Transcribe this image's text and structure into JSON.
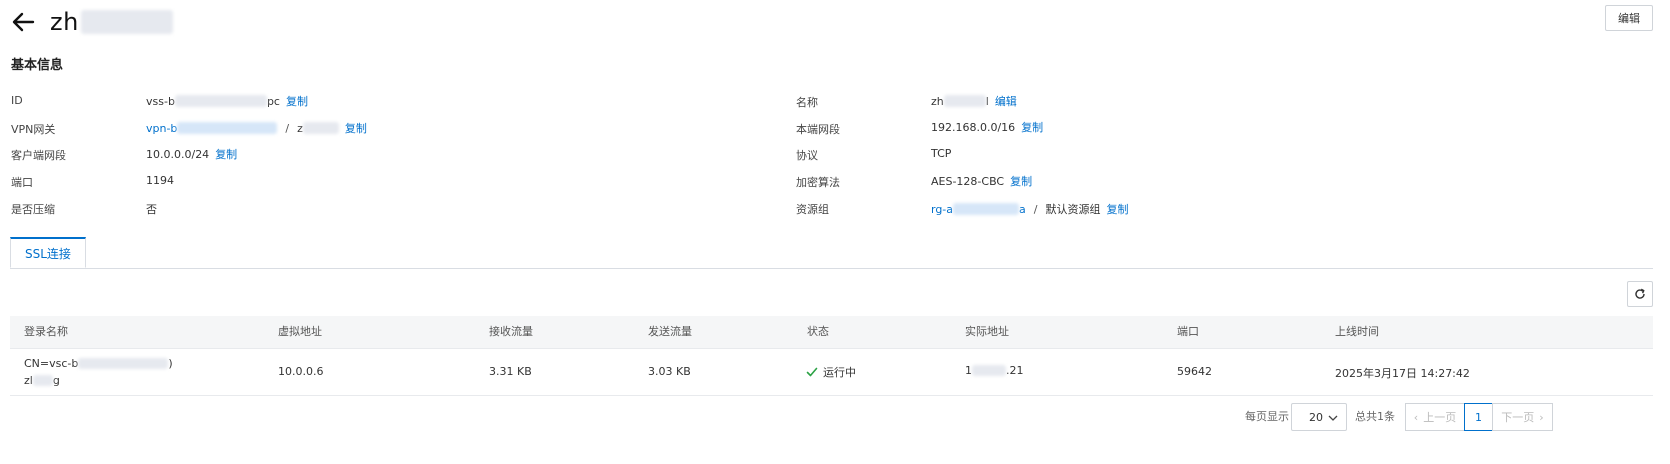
{
  "header": {
    "title": "zh",
    "edit_label": "编辑"
  },
  "basic_info": {
    "section_title": "基本信息",
    "left": {
      "id_label": "ID",
      "id_prefix": "vss-b",
      "id_suffix": "pc",
      "id_copy": "复制",
      "gateway_label": "VPN网关",
      "gateway_prefix": "vpn-b",
      "gateway_sep": "/",
      "gateway_name": "z",
      "gateway_copy": "复制",
      "client_cidr_label": "客户端网段",
      "client_cidr": "10.0.0.0/24",
      "client_cidr_copy": "复制",
      "port_label": "端口",
      "port": "1194",
      "compress_label": "是否压缩",
      "compress": "否"
    },
    "right": {
      "name_label": "名称",
      "name_prefix": "zh",
      "name_suffix": "l",
      "name_edit": "编辑",
      "local_cidr_label": "本端网段",
      "local_cidr": "192.168.0.0/16",
      "local_cidr_copy": "复制",
      "protocol_label": "协议",
      "protocol": "TCP",
      "cipher_label": "加密算法",
      "cipher": "AES-128-CBC",
      "cipher_copy": "复制",
      "rg_label": "资源组",
      "rg_prefix": "rg-a",
      "rg_suffix": "a",
      "rg_sep": "/",
      "rg_name": "默认资源组",
      "rg_copy": "复制"
    }
  },
  "tabs": [
    {
      "label": "SSL连接",
      "active": true
    }
  ],
  "table": {
    "columns": [
      "登录名称",
      "虚拟地址",
      "接收流量",
      "发送流量",
      "状态",
      "实际地址",
      "端口",
      "上线时间"
    ],
    "rows": [
      {
        "login_line1_prefix": "CN=vsc-b",
        "login_line1_suffix": ")",
        "login_line2_prefix": "zl",
        "login_line2_suffix": "g",
        "virtual_ip": "10.0.0.6",
        "rx": "3.31 KB",
        "tx": "3.03 KB",
        "status": "运行中",
        "real_ip_prefix": "1",
        "real_ip_suffix": ".21",
        "port": "59642",
        "online_time": "2025年3月17日 14:27:42"
      }
    ]
  },
  "pagination": {
    "per_page_label": "每页显示",
    "per_page": "20",
    "total": "总共1条",
    "prev": "上一页",
    "current": "1",
    "next": "下一页"
  },
  "colors": {
    "link": "#0070cc",
    "success": "#2ba245",
    "header_bg": "#f5f6f7"
  }
}
